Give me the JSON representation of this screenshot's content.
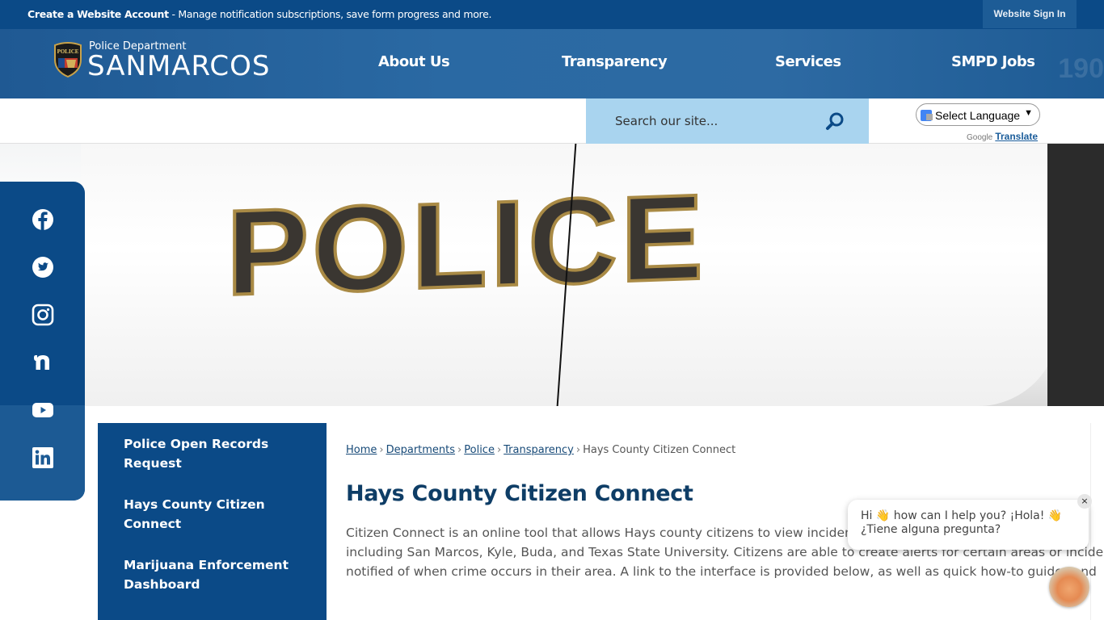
{
  "topbar": {
    "account_link": "Create a Website Account",
    "account_desc": " - Manage notification subscriptions, save form progress and more.",
    "sign_in": "Website Sign In"
  },
  "header": {
    "logo_dept": "Police Department",
    "logo_city": "SANMARCOS",
    "nav": [
      "About Us",
      "Transparency",
      "Services",
      "SMPD Jobs"
    ],
    "ghost_text": "190"
  },
  "search": {
    "placeholder": "Search our site...",
    "icon": "search-icon"
  },
  "translate": {
    "select_label": "Select Language",
    "google": "Google",
    "translate_link": "Translate"
  },
  "hero": {
    "word": "POLICE"
  },
  "social": [
    {
      "name": "facebook",
      "icon": "facebook-icon"
    },
    {
      "name": "twitter",
      "icon": "twitter-icon"
    },
    {
      "name": "instagram",
      "icon": "instagram-icon"
    },
    {
      "name": "nextdoor",
      "icon": "nextdoor-icon"
    },
    {
      "name": "youtube",
      "icon": "youtube-icon"
    },
    {
      "name": "linkedin",
      "icon": "linkedin-icon"
    }
  ],
  "subnav": [
    "Police Open Records Request",
    "Hays County Citizen Connect",
    "Marijuana Enforcement Dashboard"
  ],
  "breadcrumb": {
    "items": [
      "Home",
      "Departments",
      "Police",
      "Transparency"
    ],
    "current": "Hays County Citizen Connect",
    "separator": "›"
  },
  "page": {
    "title": "Hays County Citizen Connect",
    "paragraph_lines": [
      "Citizen Connect is an online tool that allows Hays county citizens to view incidents across Hays County, Co",
      "including San Marcos, Kyle, Buda, and Texas State University. Citizens are able to create alerts for certain areas or incide",
      "notified of when crime occurs in their area. A link to the interface is provided below, as well as quick how-to guides and"
    ]
  },
  "chat": {
    "line1": "Hi 👋 how can I help you? ¡Hola! 👋",
    "line2": "¿Tiene alguna pregunta?",
    "close": "×"
  },
  "colors": {
    "primary": "#0b4a87",
    "header": "#2a69a3",
    "search_bg": "#a9d4ef",
    "title": "#0e3d66"
  }
}
